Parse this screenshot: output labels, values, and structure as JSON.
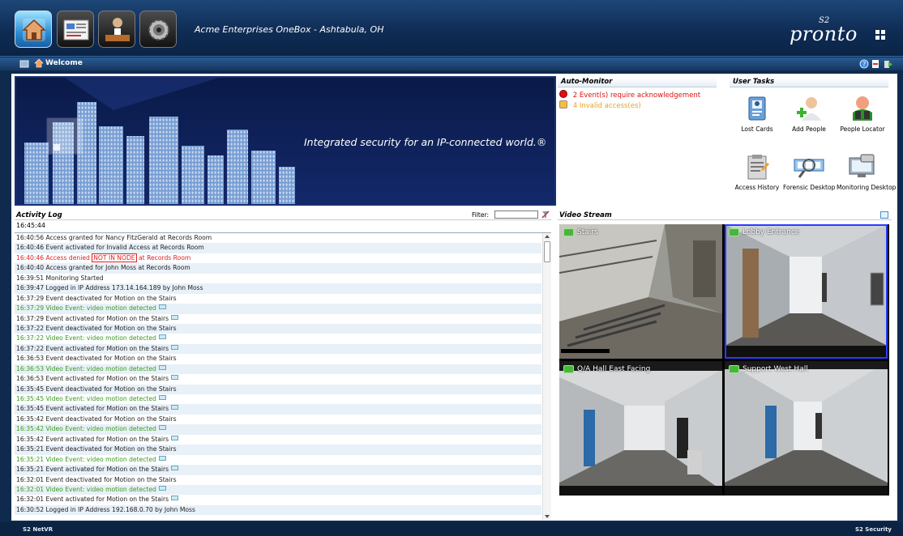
{
  "header": {
    "title": "Acme Enterprises OneBox - Ashtabula, OH",
    "brand": {
      "mark": "S2",
      "name": "pronto"
    },
    "buttons": [
      {
        "id": "home",
        "icon": "home-icon",
        "active": true
      },
      {
        "id": "reports",
        "icon": "reports-icon",
        "active": false
      },
      {
        "id": "administration",
        "icon": "person-desk-icon",
        "active": false
      },
      {
        "id": "setup",
        "icon": "gear-icon",
        "active": false
      }
    ]
  },
  "nav": {
    "page": "Welcome"
  },
  "banner": {
    "tagline": "Integrated security for an IP-connected world.®"
  },
  "auto_monitor": {
    "title": "Auto-Monitor",
    "items": [
      {
        "count": "2",
        "text": "Event(s) require acknowledgement",
        "color": "#e01010",
        "icon": "alarm-icon"
      },
      {
        "count": "4",
        "text": "Invalid access(es)",
        "color": "#e8a020",
        "icon": "warning-person-icon"
      }
    ]
  },
  "user_tasks": {
    "title": "User Tasks",
    "items": [
      {
        "label": "Lost Cards",
        "icon": "id-card-icon"
      },
      {
        "label": "Add People",
        "icon": "add-person-icon"
      },
      {
        "label": "People Locator",
        "icon": "binoculars-person-icon"
      },
      {
        "label": "Access History",
        "icon": "clipboard-icon"
      },
      {
        "label": "Forensic Desktop",
        "icon": "film-magnifier-icon"
      },
      {
        "label": "Monitoring Desktop",
        "icon": "monitor-camera-icon"
      }
    ]
  },
  "activity_log": {
    "title": "Activity Log",
    "filter_label": "Filter:",
    "filter_value": "",
    "clock": "16:45:44",
    "rows": [
      {
        "text": "16:40:56 Access granted for Nancy FitzGerald at Records Room",
        "style": "normal",
        "cam": false
      },
      {
        "text": "16:40:46 Event activated for Invalid Access at Records Room",
        "style": "normal",
        "cam": false
      },
      {
        "text": "16:40:46 Access denied ",
        "boxed": "NOT IN NODE",
        "suffix": " at Records Room",
        "style": "red",
        "cam": false
      },
      {
        "text": "16:40:40 Access granted for John Moss at Records Room",
        "style": "normal",
        "cam": false
      },
      {
        "text": "16:39:51 Monitoring Started",
        "style": "normal",
        "cam": false
      },
      {
        "text": "16:39:47 Logged in IP Address 173.14.164.189 by John Moss",
        "style": "normal",
        "cam": false
      },
      {
        "text": "16:37:29 Event deactivated for Motion on the Stairs",
        "style": "normal",
        "cam": false
      },
      {
        "text": "16:37:29 Video Event: video motion detected",
        "style": "green",
        "cam": true
      },
      {
        "text": "16:37:29 Event activated for Motion on the Stairs",
        "style": "normal",
        "cam": true
      },
      {
        "text": "16:37:22 Event deactivated for Motion on the Stairs",
        "style": "normal",
        "cam": false
      },
      {
        "text": "16:37:22 Video Event: video motion detected",
        "style": "green",
        "cam": true
      },
      {
        "text": "16:37:22 Event activated for Motion on the Stairs",
        "style": "normal",
        "cam": true
      },
      {
        "text": "16:36:53 Event deactivated for Motion on the Stairs",
        "style": "normal",
        "cam": false
      },
      {
        "text": "16:36:53 Video Event: video motion detected",
        "style": "green",
        "cam": true
      },
      {
        "text": "16:36:53 Event activated for Motion on the Stairs",
        "style": "normal",
        "cam": true
      },
      {
        "text": "16:35:45 Event deactivated for Motion on the Stairs",
        "style": "normal",
        "cam": false
      },
      {
        "text": "16:35:45 Video Event: video motion detected",
        "style": "green",
        "cam": true
      },
      {
        "text": "16:35:45 Event activated for Motion on the Stairs",
        "style": "normal",
        "cam": true
      },
      {
        "text": "16:35:42 Event deactivated for Motion on the Stairs",
        "style": "normal",
        "cam": false
      },
      {
        "text": "16:35:42 Video Event: video motion detected",
        "style": "green",
        "cam": true
      },
      {
        "text": "16:35:42 Event activated for Motion on the Stairs",
        "style": "normal",
        "cam": true
      },
      {
        "text": "16:35:21 Event deactivated for Motion on the Stairs",
        "style": "normal",
        "cam": false
      },
      {
        "text": "16:35:21 Video Event: video motion detected",
        "style": "green",
        "cam": true
      },
      {
        "text": "16:35:21 Event activated for Motion on the Stairs",
        "style": "normal",
        "cam": true
      },
      {
        "text": "16:32:01 Event deactivated for Motion on the Stairs",
        "style": "normal",
        "cam": false
      },
      {
        "text": "16:32:01 Video Event: video motion detected",
        "style": "green",
        "cam": true
      },
      {
        "text": "16:32:01 Event activated for Motion on the Stairs",
        "style": "normal",
        "cam": true
      },
      {
        "text": "16:30:52 Logged in IP Address 192.168.0.70 by John Moss",
        "style": "normal",
        "cam": false
      }
    ]
  },
  "video_stream": {
    "title": "Video Stream",
    "cameras": [
      {
        "name": "Stairs",
        "selected": false
      },
      {
        "name": "Lobby Entrance",
        "selected": true
      },
      {
        "name": "Q/A Hall East Facing",
        "selected": false
      },
      {
        "name": "Support West Hall",
        "selected": false
      }
    ]
  },
  "footer": {
    "left": "S2 NetVR",
    "right": "S2 Security"
  },
  "colors": {
    "accent": "#1d4777",
    "red": "#e02020",
    "green": "#3a9a1f",
    "orange": "#e8a020"
  }
}
